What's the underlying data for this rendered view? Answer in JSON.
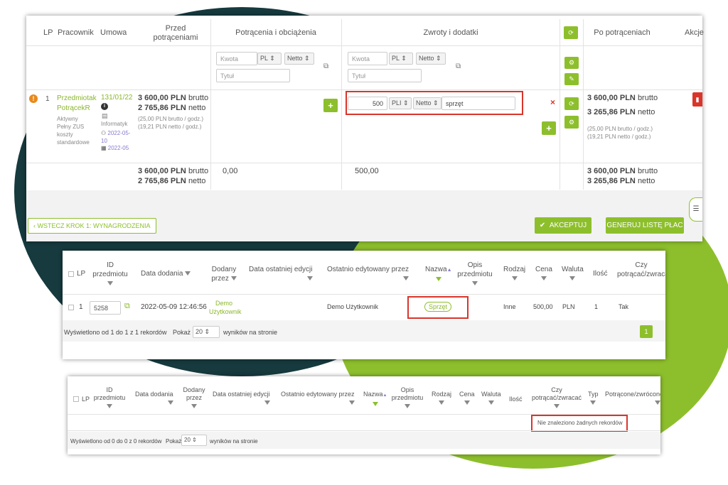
{
  "top": {
    "headers": {
      "lp": "LP",
      "pracownik": "Pracownik",
      "umowa": "Umowa",
      "przed": "Przed potrąceniami",
      "potracenia": "Potrącenia i obciążenia",
      "zwroty": "Zwroty i dodatki",
      "po": "Po potrąceniach",
      "akcje": "Akcje"
    },
    "deductions_form": {
      "kwota_placeholder": "Kwota",
      "currency": "PL",
      "type": "Netto",
      "tytul_placeholder": "Tytuł"
    },
    "refunds_form": {
      "kwota_placeholder": "Kwota",
      "currency": "PL",
      "type": "Netto",
      "tytul_placeholder": "Tytuł"
    },
    "row": {
      "lp": "1",
      "name": "Przedmiotak PotrącekR",
      "status1": "Aktywny",
      "status2": "Pełny ZUS",
      "status3": "koszty",
      "status4": "standardowe",
      "contract": "131/01/22",
      "contract_type": "Informatyk",
      "date1": "2022-05-10",
      "date2": "2022-05",
      "brutto_amt": "3 600,00 PLN",
      "brutto_lbl": "brutto",
      "netto_amt": "2 765,86 PLN",
      "netto_lbl": "netto",
      "hourly_brutto": "(25,00 PLN brutto / godz.)",
      "hourly_netto": "(19,21 PLN netto / godz.)",
      "refund_amount": "500",
      "refund_currency": "PLI",
      "refund_type": "Netto",
      "refund_title": "sprzęt",
      "po_brutto_amt": "3 600,00 PLN",
      "po_brutto_lbl": "brutto",
      "po_netto_amt": "3 265,86 PLN",
      "po_netto_lbl": "netto",
      "po_hourly_brutto": "(25,00 PLN brutto / godz.)",
      "po_hourly_netto": "(19,21 PLN netto / godz.)"
    },
    "totals": {
      "przed_brutto_amt": "3 600,00 PLN",
      "przed_brutto_lbl": "brutto",
      "przed_netto_amt": "2 765,86 PLN",
      "przed_netto_lbl": "netto",
      "potracenia": "0,00",
      "zwroty": "500,00",
      "po_brutto_amt": "3 600,00 PLN",
      "po_brutto_lbl": "brutto",
      "po_netto_amt": "3 265,86 PLN",
      "po_netto_lbl": "netto"
    },
    "buttons": {
      "back": "WSTECZ KROK 1: WYNAGRODZENIA",
      "accept": "AKCEPTUJ",
      "generate": "GENERUJ LISTĘ PŁAC"
    }
  },
  "mid": {
    "headers": {
      "lp": "LP",
      "id_line1": "ID",
      "id_line2": "przedmiotu",
      "data_dodania": "Data dodania",
      "dodany_line1": "Dodany",
      "dodany_line2": "przez",
      "data_edycji": "Data ostatniej edycji",
      "edytowany": "Ostatnio edytowany przez",
      "nazwa": "Nazwa",
      "opis_line1": "Opis",
      "opis_line2": "przedmiotu",
      "rodzaj": "Rodzaj",
      "cena": "Cena",
      "waluta": "Waluta",
      "ilosc": "Ilość",
      "czy_line1": "Czy",
      "czy_line2": "potrącać/zwracać"
    },
    "row": {
      "lp": "1",
      "id": "5258",
      "data_dodania": "2022-05-09 12:46:56",
      "dodany_line1": "Demo",
      "dodany_line2": "Użytkownik",
      "edytowany": "Demo Użytkownik",
      "nazwa": "Sprzęt",
      "rodzaj": "Inne",
      "cena": "500,00",
      "waluta": "PLN",
      "ilosc": "1",
      "czy": "Tak"
    },
    "footer": {
      "shown": "Wyświetlono od 1 do 1 z 1 rekordów",
      "pokaz": "Pokaż",
      "page_size": "20",
      "suffix": "wyników na stronie",
      "page": "1"
    }
  },
  "bottom": {
    "headers": {
      "lp": "LP",
      "id_line1": "ID",
      "id_line2": "przedmiotu",
      "data_dodania": "Data dodania",
      "dodany_line1": "Dodany",
      "dodany_line2": "przez",
      "data_edycji": "Data ostatniej edycji",
      "edytowany": "Ostatnio edytowany przez",
      "nazwa": "Nazwa",
      "opis_line1": "Opis",
      "opis_line2": "przedmiotu",
      "rodzaj": "Rodzaj",
      "cena": "Cena",
      "waluta": "Waluta",
      "ilosc": "Ilość",
      "czy_line1": "Czy",
      "czy_line2": "potrącać/zwracać",
      "typ": "Typ",
      "potracone": "Potrącone/zwrócone"
    },
    "empty": "Nie znaleziono żadnych rekordów",
    "footer": {
      "shown": "Wyświetlono od 0 do 0 z 0 rekordów",
      "pokaz": "Pokaż",
      "page_size": "20",
      "suffix": "wyników na stronie"
    }
  },
  "icons": {
    "warning": "warning-icon",
    "refresh": "refresh-icon",
    "plus": "plus-icon",
    "close": "close-icon",
    "copy": "copy-icon",
    "chat": "chat-icon",
    "trash": "trash-icon"
  },
  "colors": {
    "accent": "#8dbf2c",
    "dark": "#163a3e",
    "danger": "#d9352b",
    "warning": "#e8891b"
  }
}
